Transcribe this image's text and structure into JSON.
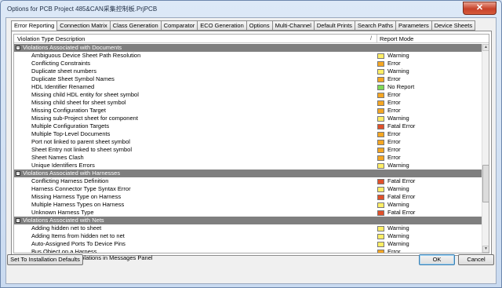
{
  "window": {
    "title": "Options for PCB Project 485&CAN采集控制板.PrjPCB",
    "close_label": "✕"
  },
  "tabs": [
    "Error Reporting",
    "Connection Matrix",
    "Class Generation",
    "Comparator",
    "ECO Generation",
    "Options",
    "Multi-Channel",
    "Default Prints",
    "Search Paths",
    "Parameters",
    "Device Sheets"
  ],
  "grid": {
    "col_type": "Violation Type Description",
    "col_sep": "/",
    "col_mode": "Report Mode"
  },
  "rows": [
    {
      "group": true,
      "label": "Violations Associated with Documents"
    },
    {
      "label": "Ambiguous Device Sheet Path Resolution",
      "mode": "Warning"
    },
    {
      "label": "Conflicting Constraints",
      "mode": "Error"
    },
    {
      "label": "Duplicate sheet numbers",
      "mode": "Warning"
    },
    {
      "label": "Duplicate Sheet Symbol Names",
      "mode": "Error"
    },
    {
      "label": "HDL Identifier Renamed",
      "mode": "No Report"
    },
    {
      "label": "Missing child HDL entity for sheet symbol",
      "mode": "Error"
    },
    {
      "label": "Missing child sheet for sheet symbol",
      "mode": "Error"
    },
    {
      "label": "Missing Configuration Target",
      "mode": "Error"
    },
    {
      "label": "Missing sub-Project sheet for component",
      "mode": "Warning"
    },
    {
      "label": "Multiple Configuration Targets",
      "mode": "Fatal Error"
    },
    {
      "label": "Multiple Top-Level Documents",
      "mode": "Error"
    },
    {
      "label": "Port not linked to parent sheet symbol",
      "mode": "Error"
    },
    {
      "label": "Sheet Entry not linked to sheet symbol",
      "mode": "Error"
    },
    {
      "label": "Sheet Names Clash",
      "mode": "Error"
    },
    {
      "label": "Unique Identifiers Errors",
      "mode": "Warning"
    },
    {
      "group": true,
      "label": "Violations Associated with Harnesses"
    },
    {
      "label": "Conflicting Harness Definition",
      "mode": "Fatal Error"
    },
    {
      "label": "Harness Connector Type Syntax Error",
      "mode": "Warning"
    },
    {
      "label": "Missing Harness Type on Harness",
      "mode": "Fatal Error"
    },
    {
      "label": "Multiple Harness Types on Harness",
      "mode": "Warning"
    },
    {
      "label": "Unknown Harness Type",
      "mode": "Fatal Error"
    },
    {
      "group": true,
      "label": "Violations Associated with Nets"
    },
    {
      "label": "Adding hidden net to sheet",
      "mode": "Warning"
    },
    {
      "label": "Adding Items from hidden net to net",
      "mode": "Warning"
    },
    {
      "label": "Auto-Assigned Ports To Device Pins",
      "mode": "Warning"
    },
    {
      "label": "Bus Object on a Harness",
      "mode": "Error"
    }
  ],
  "mode_colors": {
    "Warning": "#ffee66",
    "Error": "#f5a623",
    "Fatal Error": "#e0502a",
    "No Report": "#7ed957"
  },
  "suppress_label": "Report Suppressed Violations in Messages Panel",
  "buttons": {
    "defaults": "Set To Installation Defaults",
    "ok": "OK",
    "cancel": "Cancel"
  }
}
